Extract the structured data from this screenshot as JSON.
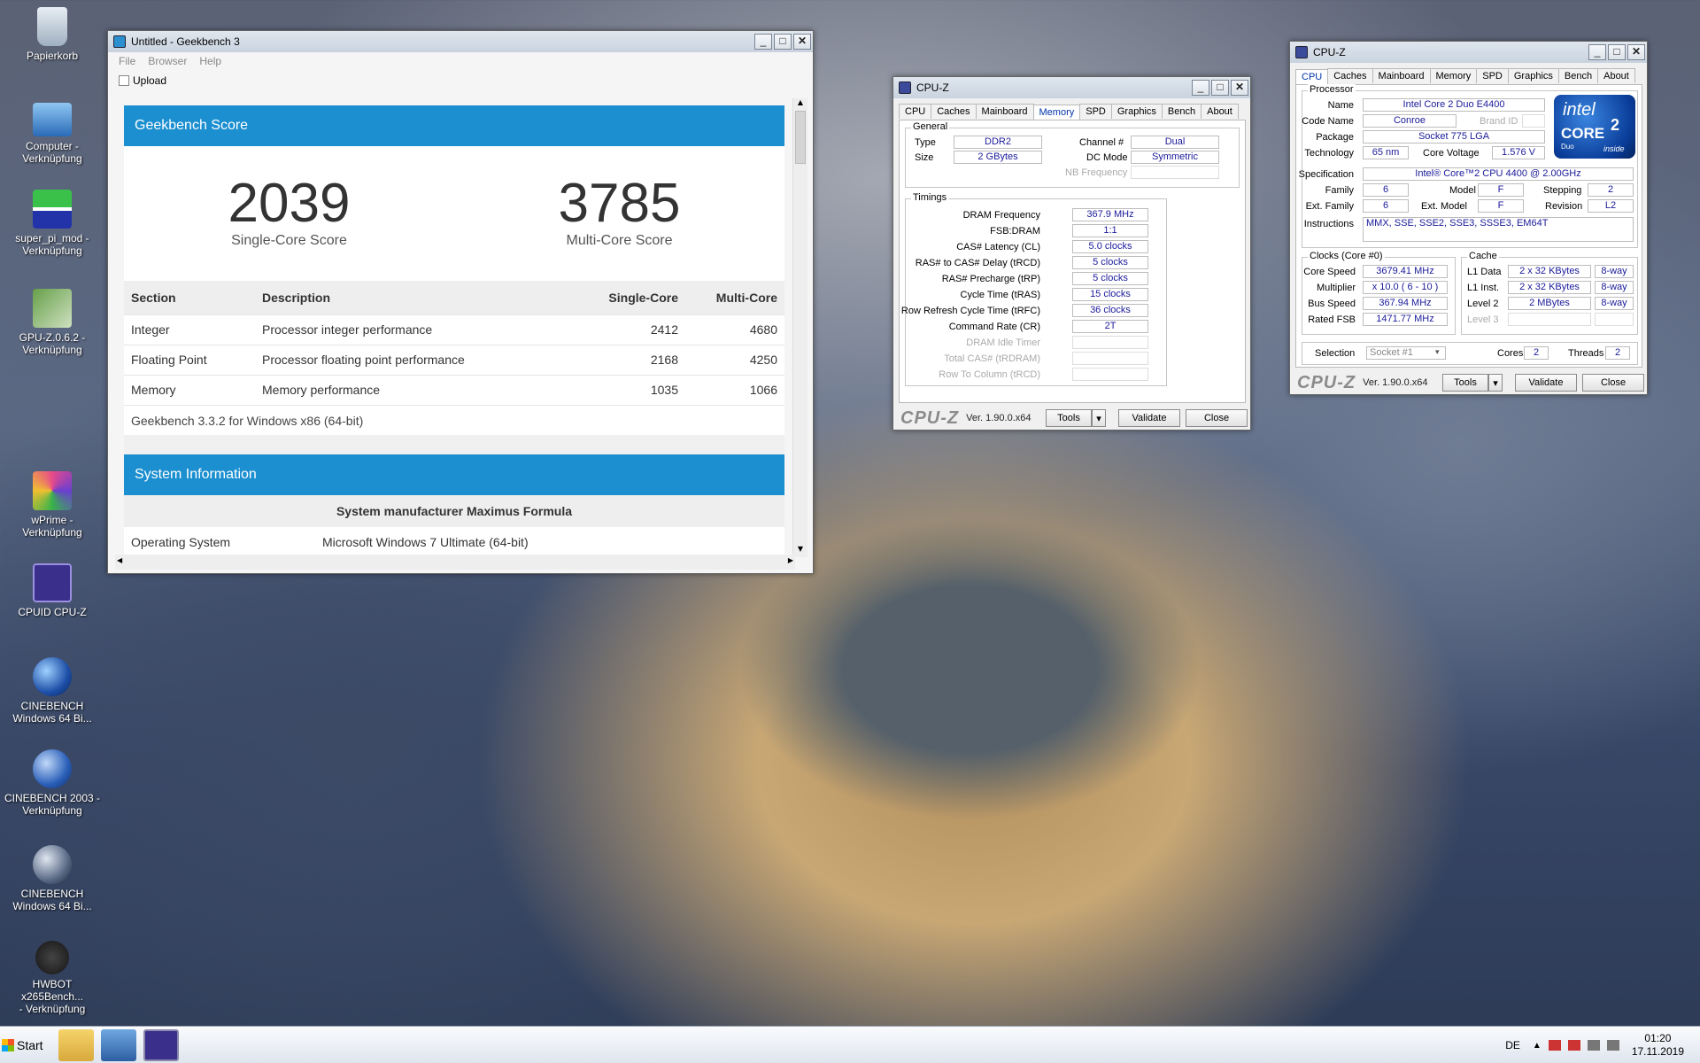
{
  "desktop": {
    "icons": [
      {
        "l1": "Papierkorb",
        "l2": ""
      },
      {
        "l1": "Computer -",
        "l2": "Verknüpfung"
      },
      {
        "l1": "super_pi_mod -",
        "l2": "Verknüpfung"
      },
      {
        "l1": "GPU-Z.0.6.2 -",
        "l2": "Verknüpfung"
      },
      {
        "l1": "wPrime -",
        "l2": "Verknüpfung"
      },
      {
        "l1": "CPUID CPU-Z",
        "l2": ""
      },
      {
        "l1": "CINEBENCH",
        "l2": "Windows 64 Bi..."
      },
      {
        "l1": "CINEBENCH 2003 -",
        "l2": "Verknüpfung"
      },
      {
        "l1": "CINEBENCH",
        "l2": "Windows 64 Bi..."
      },
      {
        "l1": "HWBOT x265Bench...",
        "l2": "- Verknüpfung"
      }
    ]
  },
  "geekbench": {
    "title": "Untitled - Geekbench 3",
    "menu": [
      "File",
      "Browser",
      "Help"
    ],
    "upload": "Upload",
    "score_header": "Geekbench Score",
    "single_score": "2039",
    "single_label": "Single-Core Score",
    "multi_score": "3785",
    "multi_label": "Multi-Core Score",
    "columns": [
      "Section",
      "Description",
      "Single-Core",
      "Multi-Core"
    ],
    "rows": [
      [
        "Integer",
        "Processor integer performance",
        "2412",
        "4680"
      ],
      [
        "Floating Point",
        "Processor floating point performance",
        "2168",
        "4250"
      ],
      [
        "Memory",
        "Memory performance",
        "1035",
        "1066"
      ]
    ],
    "footer": "Geekbench 3.3.2 for Windows x86 (64-bit)",
    "sys_header": "System Information",
    "sys_manufacturer": "System manufacturer Maximus Formula",
    "os_label": "Operating System",
    "os_value": "Microsoft Windows 7 Ultimate (64-bit)"
  },
  "cpuz_memory": {
    "title": "CPU-Z",
    "tabs": [
      "CPU",
      "Caches",
      "Mainboard",
      "Memory",
      "SPD",
      "Graphics",
      "Bench",
      "About"
    ],
    "general": "General",
    "type_label": "Type",
    "type": "DDR2",
    "size_label": "Size",
    "size": "2 GBytes",
    "channel_label": "Channel #",
    "channel": "Dual",
    "dcmode_label": "DC Mode",
    "dcmode": "Symmetric",
    "nbfreq_label": "NB Frequency",
    "timings": "Timings",
    "t_labels": [
      "DRAM Frequency",
      "FSB:DRAM",
      "CAS# Latency (CL)",
      "RAS# to CAS# Delay (tRCD)",
      "RAS# Precharge (tRP)",
      "Cycle Time (tRAS)",
      "Row Refresh Cycle Time (tRFC)",
      "Command Rate (CR)",
      "DRAM Idle Timer",
      "Total CAS# (tRDRAM)",
      "Row To Column (tRCD)"
    ],
    "t_values": [
      "367.9 MHz",
      "1:1",
      "5.0 clocks",
      "5 clocks",
      "5 clocks",
      "15 clocks",
      "36 clocks",
      "2T",
      "",
      "",
      ""
    ],
    "logo": "CPU-Z",
    "version": "Ver. 1.90.0.x64",
    "tools": "Tools",
    "validate": "Validate",
    "close": "Close"
  },
  "cpuz_cpu": {
    "title": "CPU-Z",
    "tabs": [
      "CPU",
      "Caches",
      "Mainboard",
      "Memory",
      "SPD",
      "Graphics",
      "Bench",
      "About"
    ],
    "processor": "Processor",
    "name_label": "Name",
    "name": "Intel Core 2 Duo E4400",
    "codename_label": "Code Name",
    "codename": "Conroe",
    "brandid_label": "Brand ID",
    "package_label": "Package",
    "package": "Socket 775 LGA",
    "tech_label": "Technology",
    "tech": "65 nm",
    "voltage_label": "Core Voltage",
    "voltage": "1.576 V",
    "spec_label": "Specification",
    "spec": "Intel® Core™2 CPU          4400  @ 2.00GHz",
    "family_label": "Family",
    "family": "6",
    "model_label": "Model",
    "model": "F",
    "stepping_label": "Stepping",
    "stepping": "2",
    "extfamily_label": "Ext. Family",
    "extfamily": "6",
    "extmodel_label": "Ext. Model",
    "extmodel": "F",
    "revision_label": "Revision",
    "revision": "L2",
    "instr_label": "Instructions",
    "instr": "MMX, SSE, SSE2, SSE3, SSSE3, EM64T",
    "intel_brand": "intel",
    "intel_core": "CORE",
    "intel_sup": "2",
    "intel_duo": "Duo",
    "intel_inside": "inside",
    "clocks": "Clocks (Core #0)",
    "corespeed_label": "Core Speed",
    "corespeed": "3679.41 MHz",
    "mult_label": "Multiplier",
    "mult": "x 10.0 ( 6 - 10 )",
    "bus_label": "Bus Speed",
    "bus": "367.94 MHz",
    "fsb_label": "Rated FSB",
    "fsb": "1471.77 MHz",
    "cache": "Cache",
    "l1d_label": "L1 Data",
    "l1d": "2 x 32 KBytes",
    "l1d_way": "8-way",
    "l1i_label": "L1 Inst.",
    "l1i": "2 x 32 KBytes",
    "l1i_way": "8-way",
    "l2_label": "Level 2",
    "l2": "2 MBytes",
    "l2_way": "8-way",
    "l3_label": "Level 3",
    "selection_label": "Selection",
    "selection": "Socket #1",
    "cores_label": "Cores",
    "cores": "2",
    "threads_label": "Threads",
    "threads": "2",
    "logo": "CPU-Z",
    "version": "Ver. 1.90.0.x64",
    "tools": "Tools",
    "validate": "Validate",
    "close": "Close"
  },
  "taskbar": {
    "start": "Start",
    "lang": "DE",
    "time": "01:20",
    "date": "17.11.2019"
  }
}
